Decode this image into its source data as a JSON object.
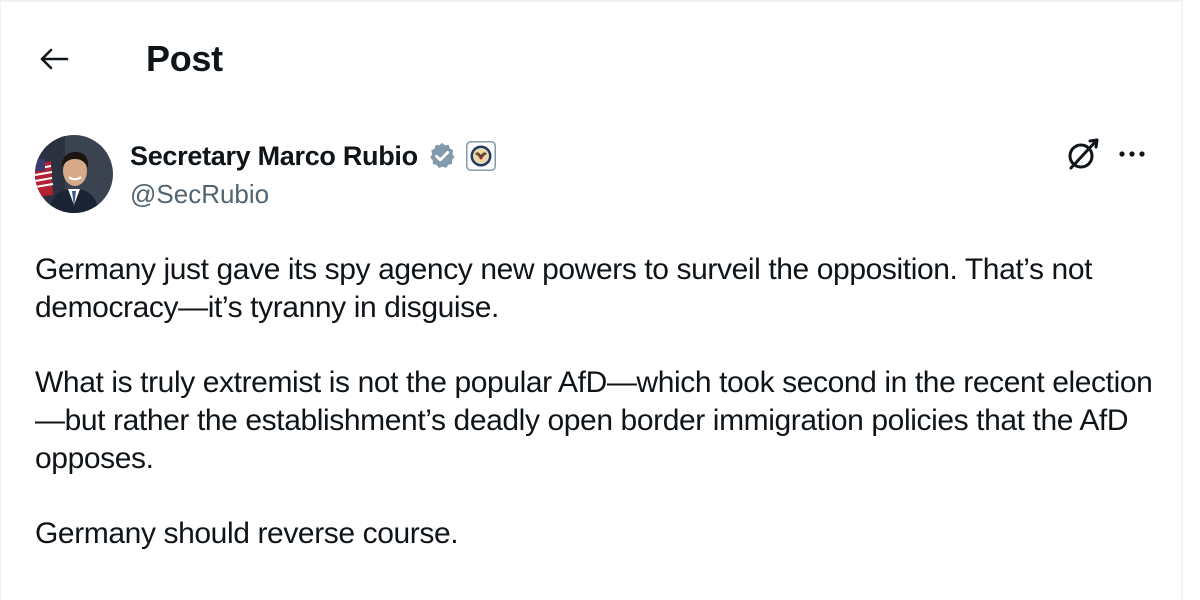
{
  "header": {
    "back_label": "Back",
    "title": "Post"
  },
  "post": {
    "author": {
      "name": "Secretary Marco Rubio",
      "handle": "@SecRubio",
      "avatar_icon": "avatar-portrait",
      "verified_icon": "verified-badge-gray",
      "affiliation_icon": "us-state-department-seal"
    },
    "actions": {
      "grok_icon": "grok-icon",
      "more_icon": "more-horizontal-icon"
    },
    "paragraphs": [
      "Germany just gave its spy agency new powers to surveil the opposition. That’s not democracy—it’s tyranny in disguise.",
      "What is truly extremist is not the popular AfD—which took second in the recent election—but rather the establishment’s deadly open border immigration policies that the AfD opposes.",
      "Germany should reverse course."
    ]
  },
  "colors": {
    "text_primary": "#0f1419",
    "text_secondary": "#536471",
    "verified_gray": "#829aab",
    "border": "#eff3f4"
  }
}
